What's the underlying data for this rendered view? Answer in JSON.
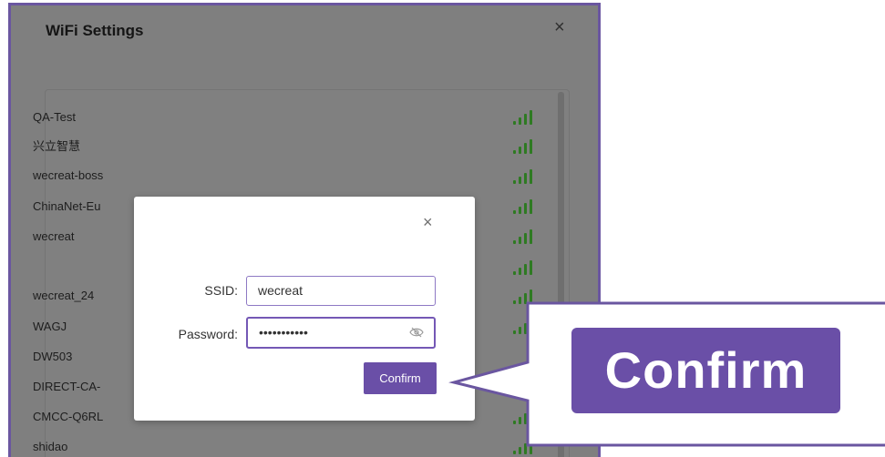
{
  "wifi_window": {
    "title": "WiFi Settings",
    "close_glyph": "×",
    "networks": [
      {
        "ssid": "QA-Test"
      },
      {
        "ssid": "兴立智慧"
      },
      {
        "ssid": "wecreat-boss"
      },
      {
        "ssid": "ChinaNet-Eu"
      },
      {
        "ssid": "wecreat"
      },
      {
        "ssid": ""
      },
      {
        "ssid": "wecreat_24"
      },
      {
        "ssid": "WAGJ"
      },
      {
        "ssid": "DW503"
      },
      {
        "ssid": "DIRECT-CA-"
      },
      {
        "ssid": "CMCC-Q6RL"
      },
      {
        "ssid": "shidao"
      }
    ],
    "signal_color": "#2e7a22"
  },
  "dialog": {
    "close_glyph": "×",
    "ssid_label": "SSID:",
    "ssid_value": "wecreat",
    "password_label": "Password:",
    "password_value": "•••••••••••",
    "confirm_label": "Confirm"
  },
  "callout": {
    "label": "Confirm",
    "color": "#6a4fa7"
  }
}
